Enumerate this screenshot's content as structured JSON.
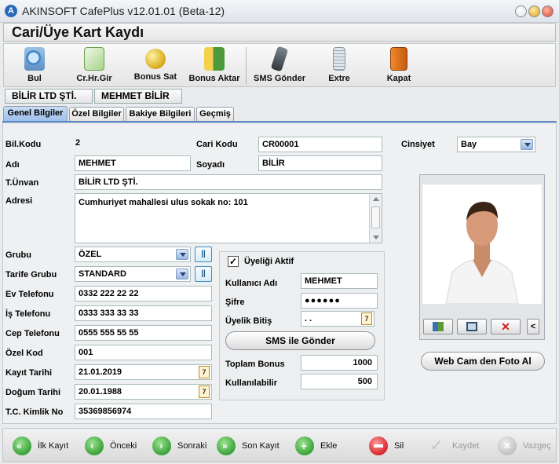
{
  "window": {
    "title": "AKINSOFT CafePlus v12.01.01 (Beta-12)"
  },
  "form": {
    "title": "Cari/Üye Kart Kaydı"
  },
  "toolbar": {
    "items": [
      {
        "label": "Bul",
        "icon": "search-icon"
      },
      {
        "label": "Cr.Hr.Gir",
        "icon": "edit-document-icon"
      },
      {
        "label": "Bonus Sat",
        "icon": "coin-icon"
      },
      {
        "label": "Bonus Aktar",
        "icon": "transfer-icon"
      },
      {
        "label": "SMS Gönder",
        "icon": "mobile-phone-icon"
      },
      {
        "label": "Extre",
        "icon": "statement-icon"
      },
      {
        "label": "Kapat",
        "icon": "exit-door-icon"
      }
    ]
  },
  "namestrip": {
    "company": "BİLİR LTD ŞTİ.",
    "person": "MEHMET BİLİR"
  },
  "tabs": [
    {
      "label": "Genel Bilgiler",
      "active": true
    },
    {
      "label": "Özel Bilgiler",
      "active": false
    },
    {
      "label": "Bakiye Bilgileri",
      "active": false
    },
    {
      "label": "Geçmiş",
      "active": false
    }
  ],
  "fields": {
    "bil_kodu": {
      "label": "Bil.Kodu",
      "value": "2"
    },
    "cari_kodu": {
      "label": "Cari Kodu",
      "value": "CR00001"
    },
    "cinsiyet": {
      "label": "Cinsiyet",
      "value": "Bay"
    },
    "adi": {
      "label": "Adı",
      "value": "MEHMET"
    },
    "soyadi": {
      "label": "Soyadı",
      "value": "BİLİR"
    },
    "t_unvan": {
      "label": "T.Ünvan",
      "value": "BİLİR LTD ŞTİ."
    },
    "adresi": {
      "label": "Adresi",
      "value": "Cumhuriyet mahallesi ulus sokak no: 101"
    },
    "grubu": {
      "label": "Grubu",
      "value": "ÖZEL"
    },
    "tarife_grubu": {
      "label": "Tarife Grubu",
      "value": "STANDARD"
    },
    "ev_telefonu": {
      "label": "Ev Telefonu",
      "value": "0332 222 22 22"
    },
    "is_telefonu": {
      "label": "İş Telefonu",
      "value": "0333 333 33 33"
    },
    "cep_telefonu": {
      "label": "Cep Telefonu",
      "value": "0555 555 55 55"
    },
    "ozel_kod": {
      "label": "Özel Kod",
      "value": "001"
    },
    "kayit_tarihi": {
      "label": "Kayıt Tarihi",
      "value": "21.01.2019"
    },
    "dogum_tarihi": {
      "label": "Doğum Tarihi",
      "value": "20.01.1988"
    },
    "tc_kimlik": {
      "label": "T.C. Kimlik No",
      "value": "35369856974"
    }
  },
  "membership": {
    "active_label": "Üyeliği Aktif",
    "active_checked": true,
    "kullanici_adi": {
      "label": "Kullanıcı Adı",
      "value": "MEHMET"
    },
    "sifre": {
      "label": "Şifre",
      "value": "●●●●●●"
    },
    "uyelik_bitis": {
      "label": "Üyelik Bitiş",
      "value": " .  ."
    },
    "sms_button": "SMS ile Gönder",
    "toplam_bonus": {
      "label": "Toplam Bonus",
      "value": "1000"
    },
    "kullanilabilir": {
      "label": "Kullanılabilir",
      "value": "500"
    }
  },
  "photo": {
    "webcam_button": "Web Cam den Foto Al",
    "more_button": "<"
  },
  "bottombar": {
    "items": [
      {
        "label": "İlk Kayıt",
        "icon": "first-record-icon",
        "color": "#3aa23a",
        "enabled": true
      },
      {
        "label": "Önceki",
        "icon": "previous-icon",
        "color": "#3aa23a",
        "enabled": true
      },
      {
        "label": "Sonraki",
        "icon": "next-icon",
        "color": "#3aa23a",
        "enabled": true
      },
      {
        "label": "Son Kayıt",
        "icon": "last-record-icon",
        "color": "#3aa23a",
        "enabled": true
      },
      {
        "label": "Ekle",
        "icon": "add-icon",
        "color": "#3aa23a",
        "enabled": true
      },
      {
        "label": "Sil",
        "icon": "delete-icon",
        "color": "#d9262b",
        "enabled": true
      },
      {
        "label": "Kaydet",
        "icon": "checkmark-icon",
        "color": "#bdbdbd",
        "enabled": false
      },
      {
        "label": "Vazgeç",
        "icon": "cancel-icon",
        "color": "#bdbdbd",
        "enabled": false
      }
    ]
  }
}
